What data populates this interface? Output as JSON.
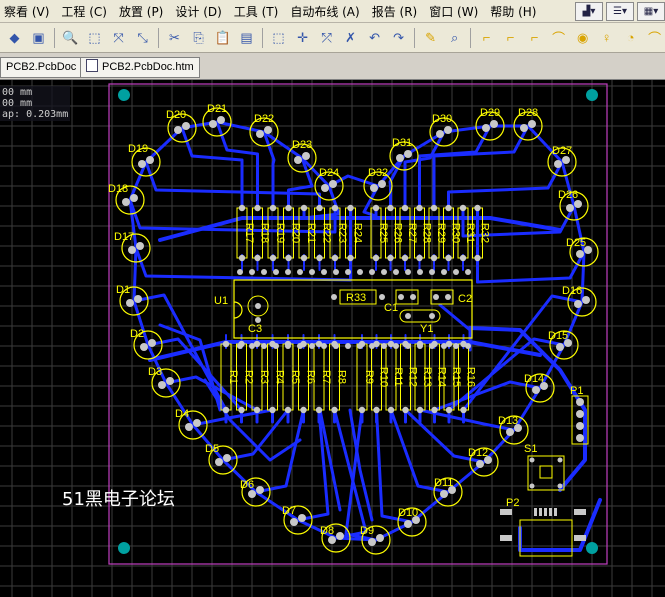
{
  "menu": [
    "察看 (V)",
    "工程 (C)",
    "放置 (P)",
    "设计 (D)",
    "工具 (T)",
    "自动布线 (A)",
    "报告 (R)",
    "窗口 (W)",
    "帮助 (H)"
  ],
  "tabs": [
    "PCB2.PcbDoc",
    "PCB2.PcbDoc.htm"
  ],
  "info": {
    "line1": "00 mm",
    "line2": "00 mm",
    "line3": "ap: 0.203mm"
  },
  "watermark": "51黑电子论坛",
  "colors": {
    "background": "#000000",
    "grid": "#3c3c3c",
    "trace": "#1a2cff",
    "silk": "#ffff00",
    "keepout": "#c040c0",
    "pad": "#c8c8c8",
    "hole": "#00a0a0"
  },
  "leds_outer": [
    "D20",
    "D21",
    "D22",
    "D23",
    "D24",
    "D19",
    "D18",
    "D17",
    "D1",
    "D2",
    "D3",
    "D4",
    "D5",
    "D6",
    "D7",
    "D8",
    "D9",
    "D10",
    "D11",
    "D12",
    "D13",
    "D14",
    "D15",
    "D16",
    "D25",
    "D26",
    "D27",
    "D28",
    "D29",
    "D30",
    "D31",
    "D32"
  ],
  "resistors_top": [
    "R17",
    "R18",
    "R19",
    "R20",
    "R21",
    "R22",
    "R23",
    "R24",
    "R25",
    "R26",
    "R27",
    "R28",
    "R29",
    "R30",
    "R31",
    "R32"
  ],
  "resistors_bottom": [
    "R1",
    "R2",
    "R3",
    "R4",
    "R5",
    "R6",
    "R7",
    "R8",
    "R9",
    "R10",
    "R11",
    "R12",
    "R13",
    "R14",
    "R15",
    "R16"
  ],
  "components": {
    "u1": "U1",
    "c3": "C3",
    "r33": "R33",
    "c1": "C1",
    "c2": "C2",
    "y1": "Y1",
    "p1": "P1",
    "s1": "S1",
    "p2": "P2"
  }
}
